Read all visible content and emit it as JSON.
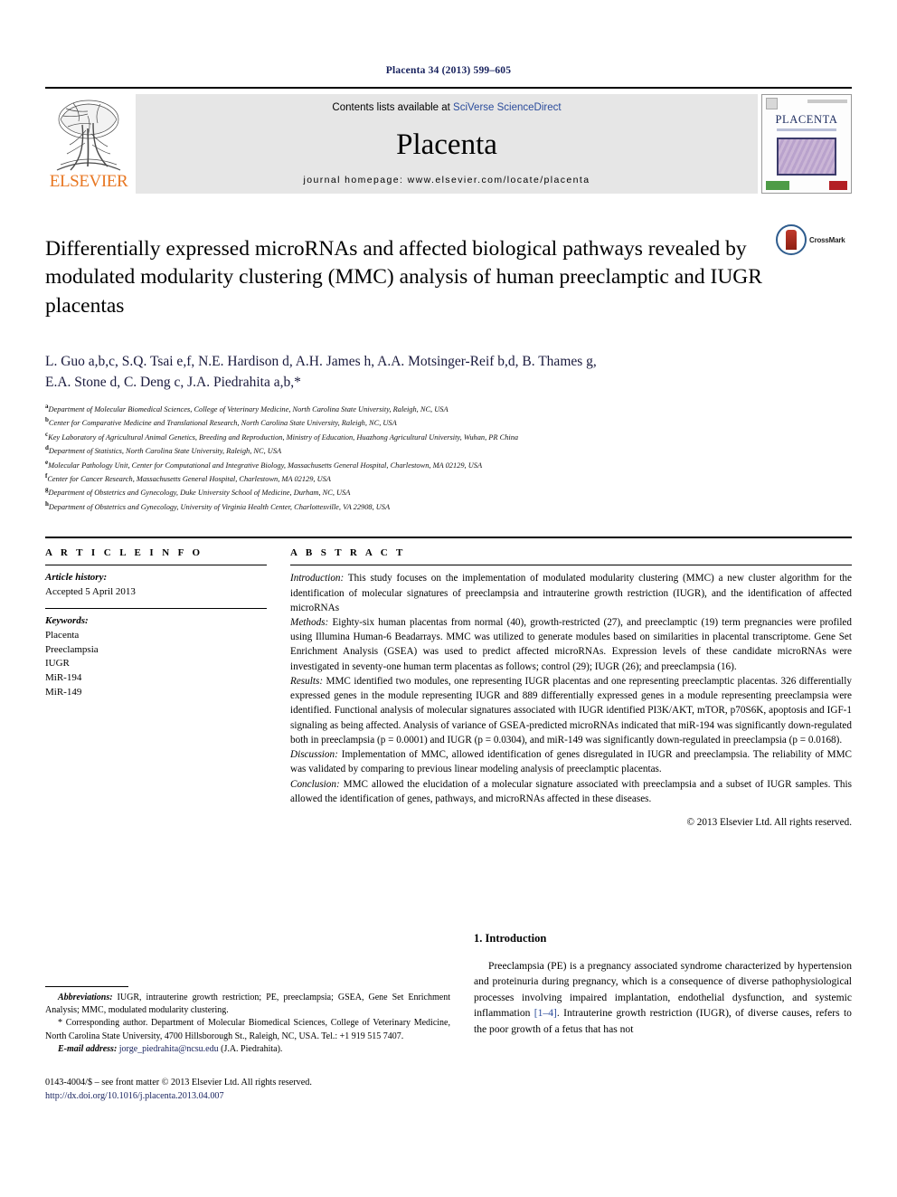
{
  "running_head": "Placenta 34 (2013) 599–605",
  "header": {
    "publisher_name": "ELSEVIER",
    "contents_prefix": "Contents lists available at ",
    "contents_link": "SciVerse ScienceDirect",
    "journal_name": "Placenta",
    "homepage": "journal homepage: www.elsevier.com/locate/placenta",
    "cover_title": "PLACENTA"
  },
  "title": "Differentially expressed microRNAs and affected biological pathways revealed by modulated modularity clustering (MMC) analysis of human preeclamptic and IUGR placentas",
  "crossmark_label": "CrossMark",
  "authors_line1": "L. Guo a,b,c, S.Q. Tsai e,f, N.E. Hardison d, A.H. James h, A.A. Motsinger-Reif b,d, B. Thames g,",
  "authors_line2": "E.A. Stone d, C. Deng c, J.A. Piedrahita a,b,*",
  "authors": [
    {
      "name": "L. Guo",
      "sup": "a,b,c"
    },
    {
      "name": "S.Q. Tsai",
      "sup": "e,f"
    },
    {
      "name": "N.E. Hardison",
      "sup": "d"
    },
    {
      "name": "A.H. James",
      "sup": "h"
    },
    {
      "name": "A.A. Motsinger-Reif",
      "sup": "b,d"
    },
    {
      "name": "B. Thames",
      "sup": "g"
    },
    {
      "name": "E.A. Stone",
      "sup": "d"
    },
    {
      "name": "C. Deng",
      "sup": "c"
    },
    {
      "name": "J.A. Piedrahita",
      "sup": "a,b,*"
    }
  ],
  "affiliations": [
    {
      "key": "a",
      "text": "Department of Molecular Biomedical Sciences, College of Veterinary Medicine, North Carolina State University, Raleigh, NC, USA"
    },
    {
      "key": "b",
      "text": "Center for Comparative Medicine and Translational Research, North Carolina State University, Raleigh, NC, USA"
    },
    {
      "key": "c",
      "text": "Key Laboratory of Agricultural Animal Genetics, Breeding and Reproduction, Ministry of Education, Huazhong Agricultural University, Wuhan, PR China"
    },
    {
      "key": "d",
      "text": "Department of Statistics, North Carolina State University, Raleigh, NC, USA"
    },
    {
      "key": "e",
      "text": "Molecular Pathology Unit, Center for Computational and Integrative Biology, Massachusetts General Hospital, Charlestown, MA 02129, USA"
    },
    {
      "key": "f",
      "text": "Center for Cancer Research, Massachusetts General Hospital, Charlestown, MA 02129, USA"
    },
    {
      "key": "g",
      "text": "Department of Obstetrics and Gynecology, Duke University School of Medicine, Durham, NC, USA"
    },
    {
      "key": "h",
      "text": "Department of Obstetrics and Gynecology, University of Virginia Health Center, Charlottesville, VA 22908, USA"
    }
  ],
  "article_info": {
    "heading": "A R T I C L E    I N F O",
    "history_label": "Article history:",
    "history_value": "Accepted 5 April 2013",
    "keywords_label": "Keywords:",
    "keywords": [
      "Placenta",
      "Preeclampsia",
      "IUGR",
      "MiR-194",
      "MiR-149"
    ]
  },
  "abstract": {
    "heading": "A B S T R A C T",
    "sections": [
      {
        "label": "Introduction:",
        "text": " This study focuses on the implementation of modulated modularity clustering (MMC) a new cluster algorithm for the identification of molecular signatures of preeclampsia and intrauterine growth restriction (IUGR), and the identification of affected microRNAs"
      },
      {
        "label": "Methods:",
        "text": " Eighty-six human placentas from normal (40), growth-restricted (27), and preeclamptic (19) term pregnancies were profiled using Illumina Human-6 Beadarrays. MMC was utilized to generate modules based on similarities in placental transcriptome. Gene Set Enrichment Analysis (GSEA) was used to predict affected microRNAs. Expression levels of these candidate microRNAs were investigated in seventy-one human term placentas as follows; control (29); IUGR (26); and preeclampsia (16)."
      },
      {
        "label": "Results:",
        "text": " MMC identified two modules, one representing IUGR placentas and one representing preeclamptic placentas. 326 differentially expressed genes in the module representing IUGR and 889 differentially expressed genes in a module representing preeclampsia were identified. Functional analysis of molecular signatures associated with IUGR identified PI3K/AKT, mTOR, p70S6K, apoptosis and IGF-1 signaling as being affected. Analysis of variance of GSEA-predicted microRNAs indicated that miR-194 was significantly down-regulated both in preeclampsia (p = 0.0001) and IUGR (p = 0.0304), and miR-149 was significantly down-regulated in preeclampsia (p = 0.0168)."
      },
      {
        "label": "Discussion:",
        "text": " Implementation of MMC, allowed identification of genes disregulated in IUGR and preeclampsia. The reliability of MMC was validated by comparing to previous linear modeling analysis of preeclamptic placentas."
      },
      {
        "label": "Conclusion:",
        "text": " MMC allowed the elucidation of a molecular signature associated with preeclampsia and a subset of IUGR samples. This allowed the identification of genes, pathways, and microRNAs affected in these diseases."
      }
    ],
    "copyright": "© 2013 Elsevier Ltd. All rights reserved."
  },
  "footnotes": {
    "abbrev_label": "Abbreviations:",
    "abbrev_text": " IUGR, intrauterine growth restriction; PE, preeclampsia; GSEA, Gene Set Enrichment Analysis; MMC, modulated modularity clustering.",
    "corresponding": "* Corresponding author. Department of Molecular Biomedical Sciences, College of Veterinary Medicine, North Carolina State University, 4700 Hillsborough St., Raleigh, NC, USA. Tel.: +1 919 515 7407.",
    "email_label": "E-mail address:",
    "email": "jorge_piedrahita@ncsu.edu",
    "email_suffix": " (J.A. Piedrahita)."
  },
  "issn_line": "0143-4004/$ – see front matter © 2013 Elsevier Ltd. All rights reserved.",
  "doi_line": "http://dx.doi.org/10.1016/j.placenta.2013.04.007",
  "introduction": {
    "heading": "1.  Introduction",
    "para_part1": "Preeclampsia (PE) is a pregnancy associated syndrome characterized by hypertension and proteinuria during pregnancy, which is a consequence of diverse pathophysiological processes involving impaired implantation, endothelial dysfunction, and systemic inflammation ",
    "ref": "[1–4]",
    "para_part2": ". Intrauterine growth restriction (IUGR), of diverse causes, refers to the poor growth of a fetus that has not"
  },
  "colors": {
    "elsevier_orange": "#E87722",
    "link_blue": "#2a4b9b",
    "dark_navy": "#16205c",
    "band_gray": "#e6e6e6"
  }
}
